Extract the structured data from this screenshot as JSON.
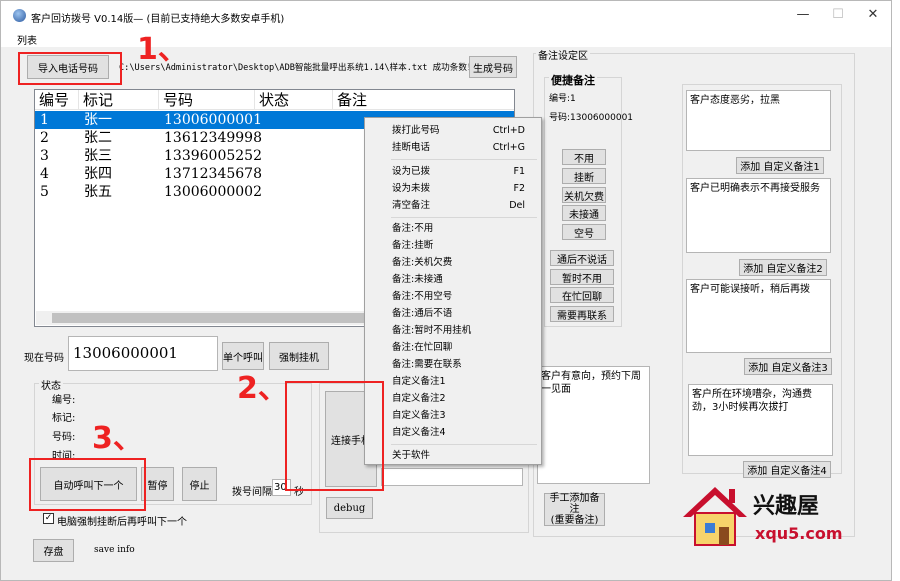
{
  "window": {
    "title": "客户回访拨号 V0.14版—  (目前已支持绝大多数安卓手机)",
    "minimize": "—",
    "maximize": "☐",
    "close": "✕"
  },
  "menu": {
    "list": "列表"
  },
  "toolbar": {
    "import_button": "导入电话号码",
    "file_path": "C:\\Users\\Administrator\\Desktop\\ADB智能批量呼出系统1.14\\样本.txt 成功条数！",
    "generate_button": "生成号码"
  },
  "list": {
    "columns": [
      "编号",
      "标记",
      "号码",
      "状态",
      "备注"
    ],
    "rows": [
      {
        "id": "1",
        "mark": "张一",
        "phone": "13006000001",
        "status": "",
        "note": ""
      },
      {
        "id": "2",
        "mark": "张二",
        "phone": "13612349998",
        "status": "",
        "note": ""
      },
      {
        "id": "3",
        "mark": "张三",
        "phone": "13396005252",
        "status": "",
        "note": ""
      },
      {
        "id": "4",
        "mark": "张四",
        "phone": "13712345678",
        "status": "",
        "note": ""
      },
      {
        "id": "5",
        "mark": "张五",
        "phone": "13006000002",
        "status": "",
        "note": ""
      }
    ]
  },
  "context_menu": {
    "group1": [
      {
        "label": "拨打此号码",
        "shortcut": "Ctrl+D"
      },
      {
        "label": "挂断电话",
        "shortcut": "Ctrl+G"
      }
    ],
    "group2": [
      {
        "label": "设为已拨",
        "shortcut": "F1"
      },
      {
        "label": "设为未拨",
        "shortcut": "F2"
      },
      {
        "label": "清空备注",
        "shortcut": "Del"
      }
    ],
    "group3": [
      {
        "label": "备注:不用"
      },
      {
        "label": "备注:挂断"
      },
      {
        "label": "备注:关机欠费"
      },
      {
        "label": "备注:未接通"
      },
      {
        "label": "备注:不用空号"
      },
      {
        "label": "备注:通后不语"
      },
      {
        "label": "备注:暂时不用挂机"
      },
      {
        "label": "备注:在忙回聊"
      },
      {
        "label": "备注:需要在联系"
      },
      {
        "label": "自定义备注1"
      },
      {
        "label": "自定义备注2"
      },
      {
        "label": "自定义备注3"
      },
      {
        "label": "自定义备注4"
      }
    ],
    "group4": [
      {
        "label": "关于软件"
      }
    ]
  },
  "current": {
    "label": "现在号码",
    "value": "13006000001",
    "single_call": "单个呼叫",
    "force_hangup": "强制挂机"
  },
  "status": {
    "title": "状态",
    "id_label": "编号:",
    "mark_label": "标记:",
    "phone_label": "号码:",
    "time_label": "时间:",
    "auto_call": "自动呼叫下一个",
    "pause": "暂停",
    "stop": "停止",
    "interval_label": "拨号间隔",
    "interval_value": "30",
    "interval_unit": "秒",
    "checkbox_label": "电脑强制挂断后再呼叫下一个",
    "checkbox_mark": "✓"
  },
  "connect_button": "连接手机",
  "debug_button": "debug",
  "save": {
    "button": "存盘",
    "info": "save info"
  },
  "notes": {
    "group_title": "备注设定区",
    "current_title": "便捷备注",
    "id_text": "编号:1",
    "phone_text": "号码:13006000001",
    "quick_buttons": [
      "不用",
      "挂断",
      "关机欠费",
      "未接通",
      "空号"
    ],
    "more_buttons": [
      "通后不说话",
      "暂时不用",
      "在忙回聊",
      "需要再联系"
    ],
    "memo_text": "客户有意向，预约下周一见面",
    "manual_add": "手工添加备注\n(重要备注)",
    "custom": [
      {
        "text": "客户态度恶劣，拉黑",
        "button": "添加 自定义备注1"
      },
      {
        "text": "客户已明确表示不再接受服务",
        "button": "添加 自定义备注2"
      },
      {
        "text": "客户可能误接听，稍后再拨",
        "button": "添加 自定义备注3"
      },
      {
        "text": "客户所在环境嘈杂，沟通费劲，3小时候再次拔打",
        "button": "添加 自定义备注4"
      }
    ]
  },
  "annotations": {
    "one": "1、",
    "two": "2、",
    "three": "3、"
  },
  "watermark": {
    "cn": "兴趣屋",
    "url": "xqu5.com"
  },
  "colors": {
    "selection": "#0078d7",
    "annotation": "#ee2222",
    "logo_red": "#c8102e"
  }
}
